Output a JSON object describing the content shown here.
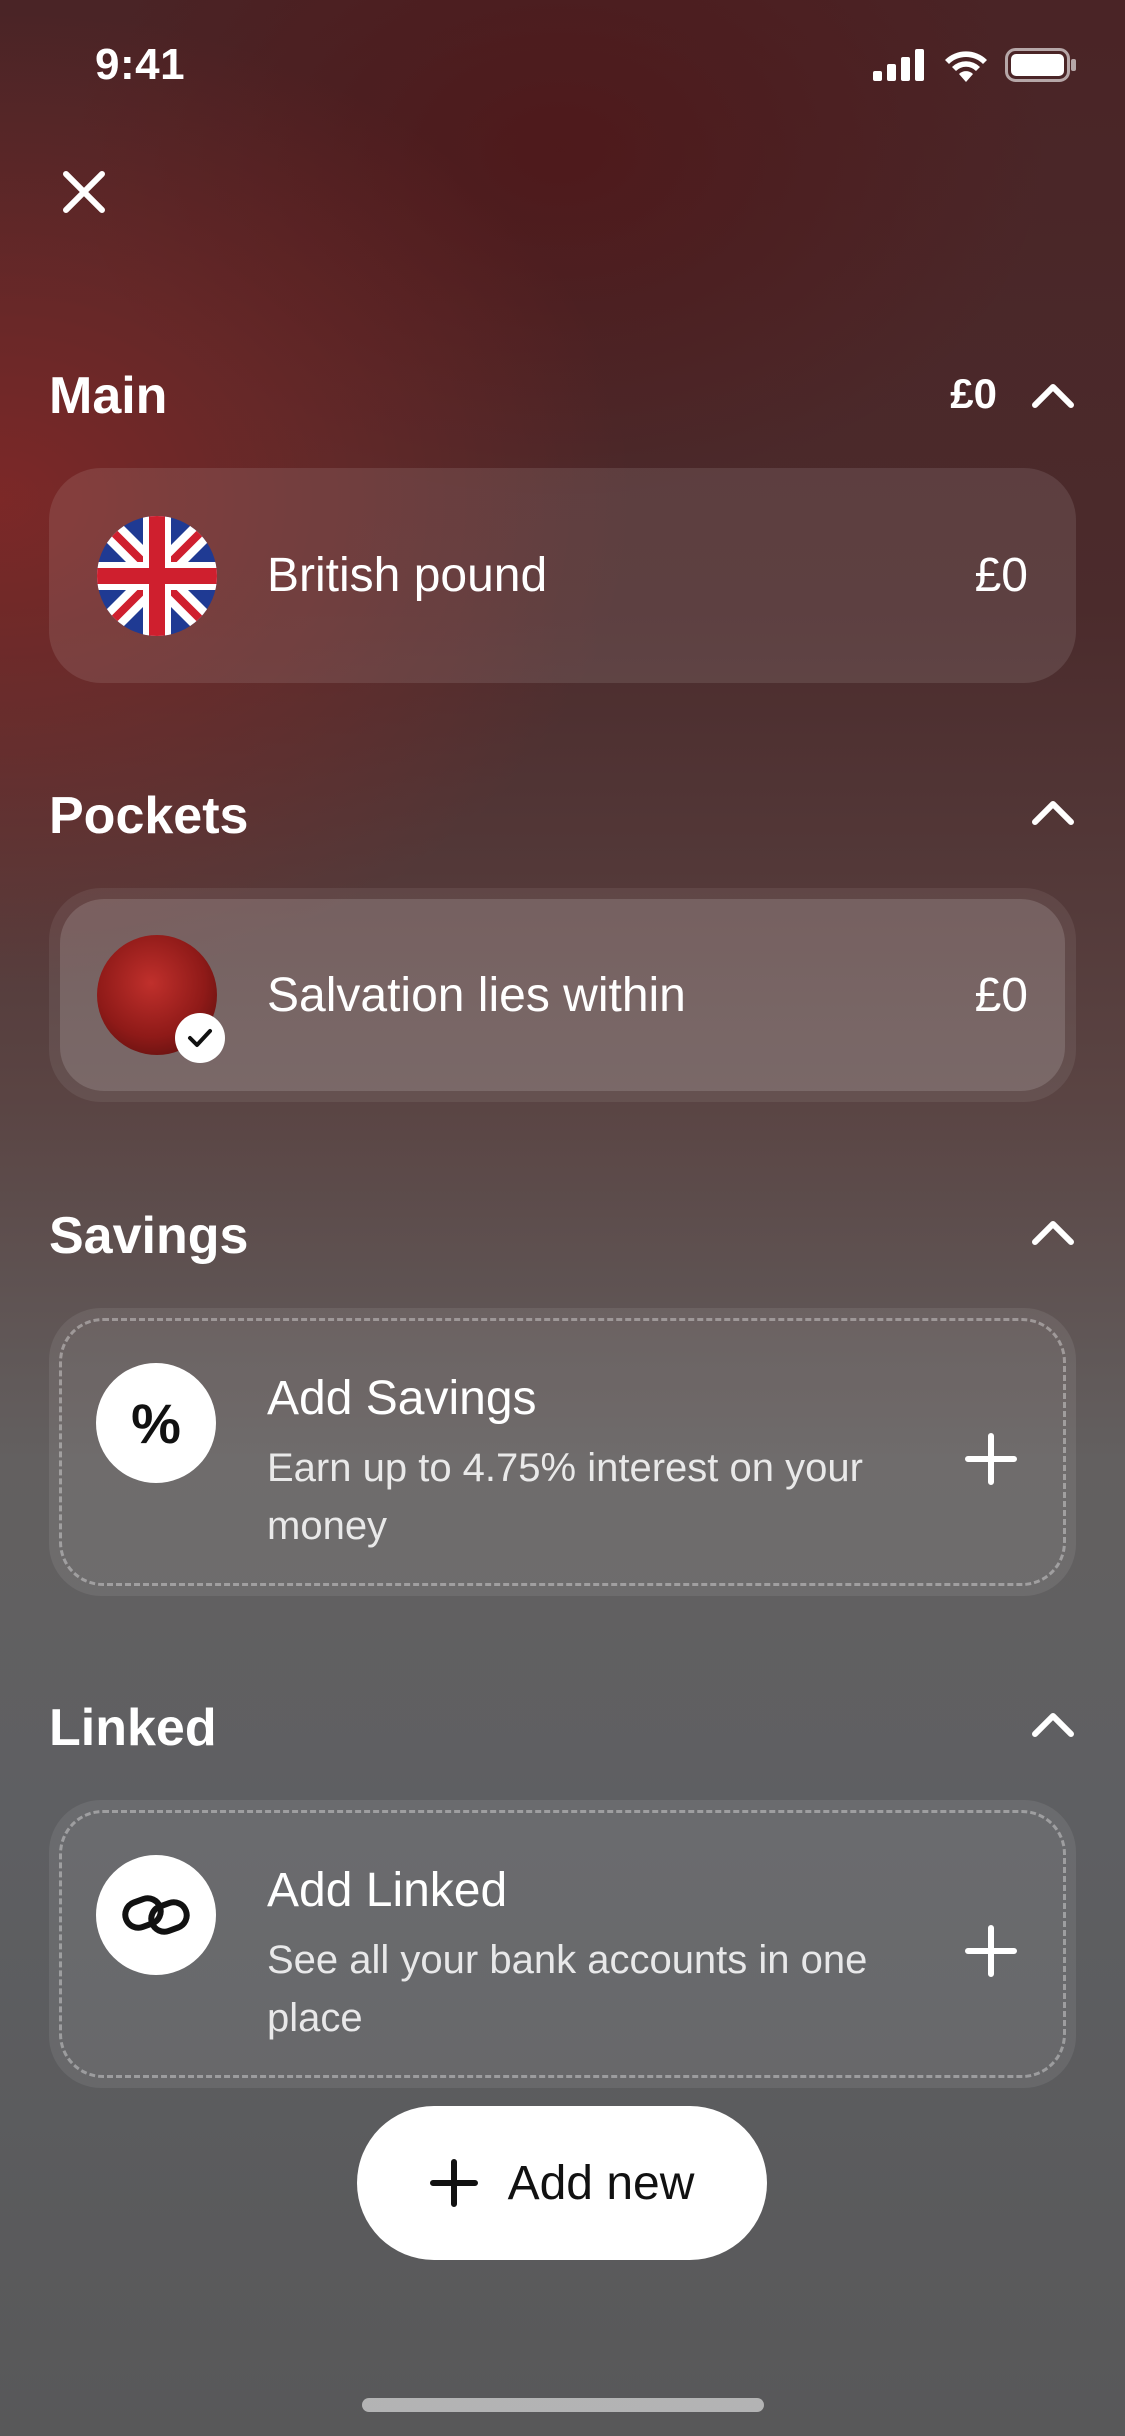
{
  "status_bar": {
    "time": "9:41"
  },
  "sections": {
    "main": {
      "title": "Main",
      "total": "£0",
      "accounts": [
        {
          "label": "British pound",
          "value": "£0",
          "icon": "uk-flag-icon"
        }
      ]
    },
    "pockets": {
      "title": "Pockets",
      "items": [
        {
          "label": "Salvation lies within",
          "value": "£0",
          "icon": "red-planet-icon",
          "selected": true
        }
      ]
    },
    "savings": {
      "title": "Savings",
      "add": {
        "title": "Add Savings",
        "subtitle": "Earn up to 4.75% interest on your money",
        "icon": "percent-icon"
      }
    },
    "linked": {
      "title": "Linked",
      "add": {
        "title": "Add Linked",
        "subtitle": "See all your bank accounts in one place",
        "icon": "link-icon"
      }
    }
  },
  "add_new": {
    "label": "Add new"
  },
  "colors": {
    "accent_red": "#8c2826",
    "card_bg": "rgba(255,255,255,0.10)"
  }
}
